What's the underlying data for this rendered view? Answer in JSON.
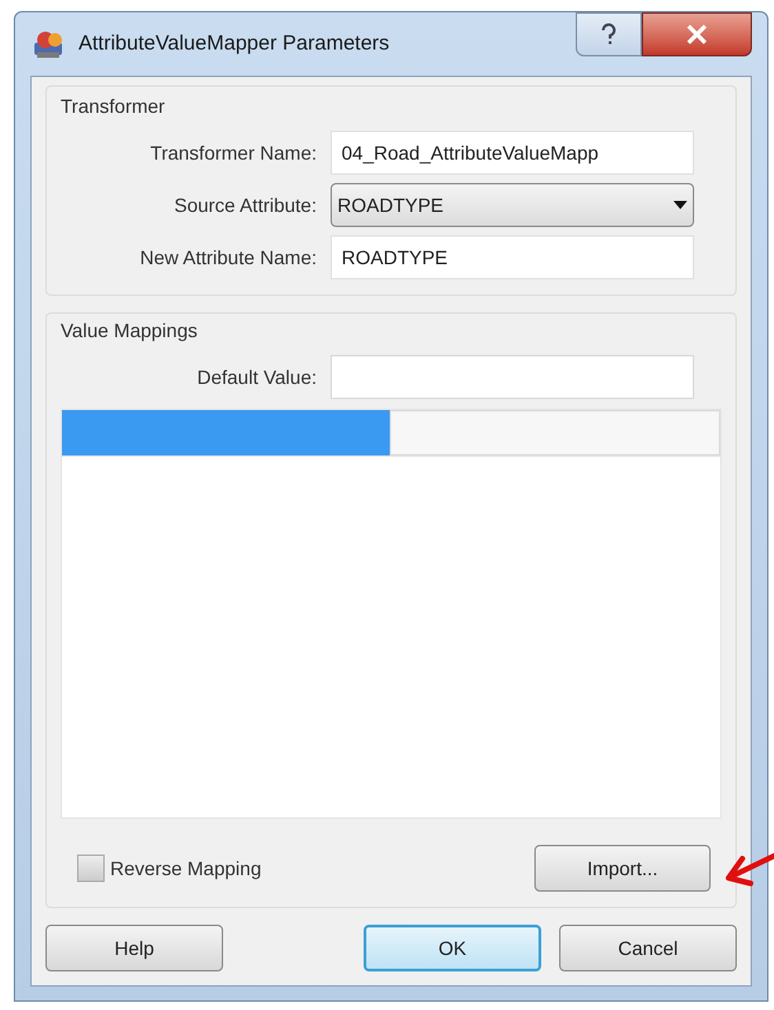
{
  "window": {
    "title": "AttributeValueMapper Parameters"
  },
  "transformer_group": {
    "title": "Transformer",
    "fields": [
      {
        "kind": "text",
        "label": "Transformer Name:",
        "value": "04_Road_AttributeValueMapp"
      },
      {
        "kind": "dropdown",
        "label": "Source Attribute:",
        "value": "ROADTYPE"
      },
      {
        "kind": "text",
        "label": "New Attribute Name:",
        "value": "ROADTYPE"
      }
    ]
  },
  "value_mappings_group": {
    "title": "Value Mappings",
    "default_value": {
      "label": "Default Value:"
    },
    "table": {
      "columns": [
        {
          "selected": true
        },
        {
          "selected": false
        }
      ]
    },
    "reverse_mapping": {
      "label": "Reverse Mapping",
      "checked": false
    },
    "import_button": "Import..."
  },
  "buttons": [
    {
      "label": "Help",
      "default": false
    },
    {
      "label": "OK",
      "default": true
    },
    {
      "label": "Cancel",
      "default": false
    }
  ]
}
